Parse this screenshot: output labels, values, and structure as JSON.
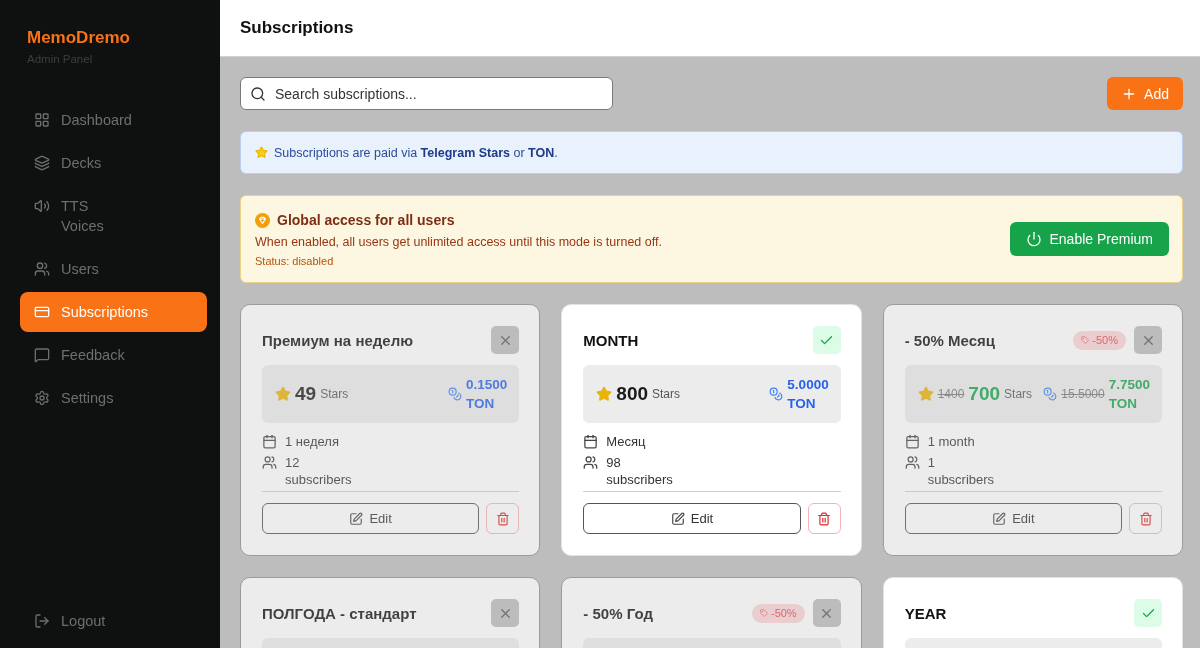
{
  "sidebar": {
    "brand": "MemoDremo",
    "subtitle": "Admin Panel",
    "items": [
      {
        "label": "Dashboard",
        "selected": false
      },
      {
        "label": "Decks",
        "selected": false
      },
      {
        "label": "TTS Voices",
        "selected": false
      },
      {
        "label": "Users",
        "selected": false
      },
      {
        "label": "Subscriptions",
        "selected": true
      },
      {
        "label": "Feedback",
        "selected": false
      },
      {
        "label": "Settings",
        "selected": false
      }
    ],
    "logout": "Logout"
  },
  "header": {
    "title": "Subscriptions"
  },
  "toolbar": {
    "search": {
      "placeholder": "Search subscriptions..."
    },
    "add_button": "Add"
  },
  "info_banner": {
    "text": "Subscriptions are paid via **Telegram Stars** or **TON**."
  },
  "premium_banner": {
    "title": "Global access for all users",
    "description": "When enabled, all users get unlimited access until this mode is turned off.",
    "status": "Status: disabled",
    "button": "Enable Premium"
  },
  "cards": [
    {
      "title": "Премиум на неделю",
      "active": false,
      "price": {
        "stars": "49",
        "stars_unit": "Stars",
        "ton": "0.1500 TON"
      },
      "duration": "1 неделя",
      "subscribers": "12 subscribers",
      "edit": "Edit"
    },
    {
      "title": "MONTH",
      "active": true,
      "price": {
        "stars": "800",
        "stars_unit": "Stars",
        "ton": "5.0000 TON"
      },
      "duration": "Месяц",
      "subscribers": "98 subscribers",
      "edit": "Edit"
    },
    {
      "title": "- 50% Месяц",
      "active": false,
      "discount": "-50%",
      "price": {
        "old_stars": "1400",
        "stars": "700",
        "stars_unit": "Stars",
        "old_ton": "15.5000",
        "ton": "7.7500 TON"
      },
      "duration": "1 month",
      "subscribers": "1 subscribers",
      "edit": "Edit"
    },
    {
      "title": "ПОЛГОДА - стандарт",
      "active": false
    },
    {
      "title": "- 50% Год",
      "active": false,
      "discount": "-50%"
    },
    {
      "title": "YEAR",
      "active": true
    }
  ]
}
